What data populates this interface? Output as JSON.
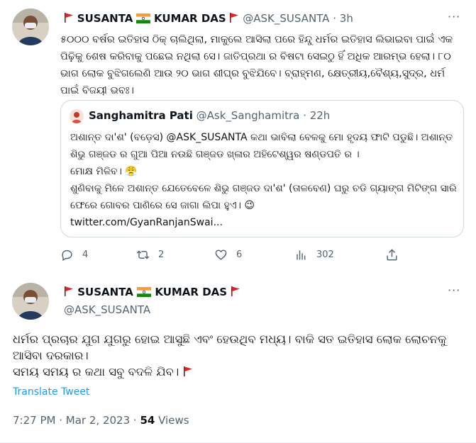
{
  "colors": {
    "accent": "#1d9bf0",
    "secondary_text": "#536471",
    "border": "#cfd9de",
    "flag_red": "#d9262b"
  },
  "tweet1": {
    "display_name": "SUSANTA",
    "display_name_2": "KUMAR DAS",
    "handle": "@ASK_SUSANTA",
    "separator": "·",
    "time": "3h",
    "more_label": "···",
    "text": "୫୦୦୦ ବର୍ଷର ଇତିହାସ ଠିକ୍ ଚାଲିଥିଲା, ମାକୁଲେ ଆସିଲା ପରେ ହିନ୍ଦୁ ଧର୍ମର ଇତିହାସ ଲିଭାଇବା ପାଇଁ ଏକ ପିଢ଼ିକୁ ଶେଷ କରିବାକୁ ପଛେଇ ନଥିଲା ସେ। ଜାତିପ୍ରଥା ର ବିଷଟା ସେଇଠୁ ହିଁ ଅଧିକ ଆରମ୍ଭ ହେଲା। ୮୦ ଭାଗ ଲୋକ ବୁଝିଗଲେଣି ଆଉ ୨୦ ଭାଗ ଶୀଘ୍ର ବୁଝିଯିବେ। ବ୍ରାହ୍ମଣ, କ୍ଷେତ୍ରୀୟ,ବୈଶ୍ୟ,ସୁଦ୍ର, ଧର୍ମ ପାଇଁ ବିଜୟୀ ଭବଃ।",
    "quoted": {
      "name": "Sanghamitra Pati",
      "handle": "@Ask_Sanghamitra",
      "separator": "·",
      "time": "22h",
      "line1": "ଅଶାନ୍ତ ଦା'ଶ' (ବଡ଼େସ) @ASK_SUSANTA କଥା ଭାବିଲା ବେଳକୁ ମୋ ହୃଦୟ ଫାଟି ପଡୁଛି। ଅଶାନ୍ତ ଶିଭୁ ଗଞ୍ଜଡ ର ଗୁଆ ପିଆ ନଉଛି ଗଞ୍ଜଡ ଖ୍ଳାର ଅହିଟେଶ୍ୱର ଷଣ୍ଡପତି ର ।",
      "line2": "ମୋକ୍ଷ ମିଳିବ।",
      "emoji1": "😤",
      "line3": "ଶୁଣିବାକୁ ମିଳେ ଅଶାନ୍ତ ଯେତେବେଳେ ଶିଭୁ ଗଞ୍ଜଡ ଦା'ଶ' (ତାଳବେଣ) ଘରୁ ଚଡି ଗ୍ୟାଙ୍ଗ ମିଟିଙ୍ଗ ସାରି ଫେରେ ଗୋବର ପାଣିରେ ସେ ଜାଗା ଲିପା ହୁଏ।",
      "emoji2": "😉",
      "link": "twitter.com/GyanRanjanSwai..."
    },
    "actions": {
      "replies": "4",
      "retweets": "2",
      "likes": "6",
      "views": "302"
    }
  },
  "tweet2": {
    "display_name": "SUSANTA",
    "display_name_2": "KUMAR DAS",
    "handle": "@ASK_SUSANTA",
    "more_label": "···",
    "line1": "ଧର୍ମର ପ୍ରଚାର ଯୁଗ ଯୁଗରୁ ହୋଇ ଆସୁଛି ଏବଂ ହେଉଥିବ ମଧ୍ୟ। ବାକି ସତ ଇତିହାସ ଲୋକ ଲୋଚନକୁ ଆସିବା ଦରକାର।",
    "line2": "ସମୟ ସମୟ ର କଥା ସବୁ ବଦଳି ଯିବ।",
    "translate_label": "Translate Tweet",
    "time": "7:27 PM",
    "separator": "·",
    "date": "Mar 2, 2023",
    "views_count": "54",
    "views_label": "Views"
  }
}
